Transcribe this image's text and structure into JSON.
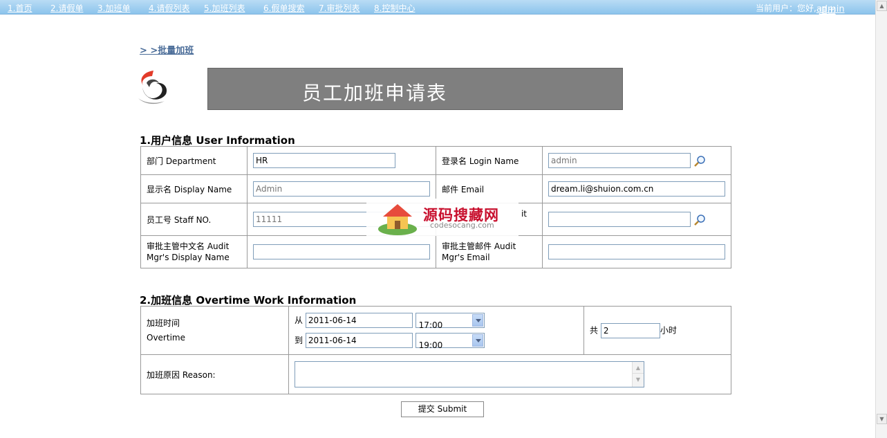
{
  "nav": {
    "items": [
      "1.首页",
      "2.请假单",
      "3.加班单",
      "4.请假列表",
      "5.加班列表",
      "6.假单搜索",
      "7.审批列表",
      "8.控制中心"
    ],
    "user_prefix": "当前用户：您好,",
    "user_name": "admin",
    "logout": "退出"
  },
  "batch_link": "> >批量加班",
  "banner_title": "员工加班申请表",
  "section1": {
    "title": "1.用户信息 User Information",
    "department_label": "部门 Department",
    "department_value": "HR",
    "login_label": "登录名 Login Name",
    "login_placeholder": "admin",
    "display_label": "显示名 Display Name",
    "display_placeholder": "Admin",
    "email_label": "邮件 Email",
    "email_value": "dream.li@shuion.com.cn",
    "staff_label": "员工号 Staff NO.",
    "staff_placeholder": "11111",
    "audit_label_fragment": "it",
    "audit_cn_label": "审批主管中文名 Audit Mgr's Display Name",
    "audit_email_label": "审批主管邮件 Audit Mgr's Email"
  },
  "section2": {
    "title": "2.加班信息 Overtime Work Information",
    "time_label_cn": "加班时间",
    "time_label_en": "Overtime",
    "from_label": "从",
    "to_label": "到",
    "from_date": "2011-06-14",
    "from_time": "17:00",
    "to_date": "2011-06-14",
    "to_time": "19:00",
    "total_prefix": "共",
    "total_value": "2",
    "total_unit": "小时",
    "reason_label": "加班原因 Reason:"
  },
  "submit_label": "提交 Submit",
  "watermark": {
    "cn": "源码搜藏网",
    "en": "codesocang.com"
  },
  "colors": {
    "nav_bg": "#9fd0f2",
    "banner_bg": "#7f7f7f",
    "link": "#4a6c98",
    "watermark": "#c8102e"
  }
}
